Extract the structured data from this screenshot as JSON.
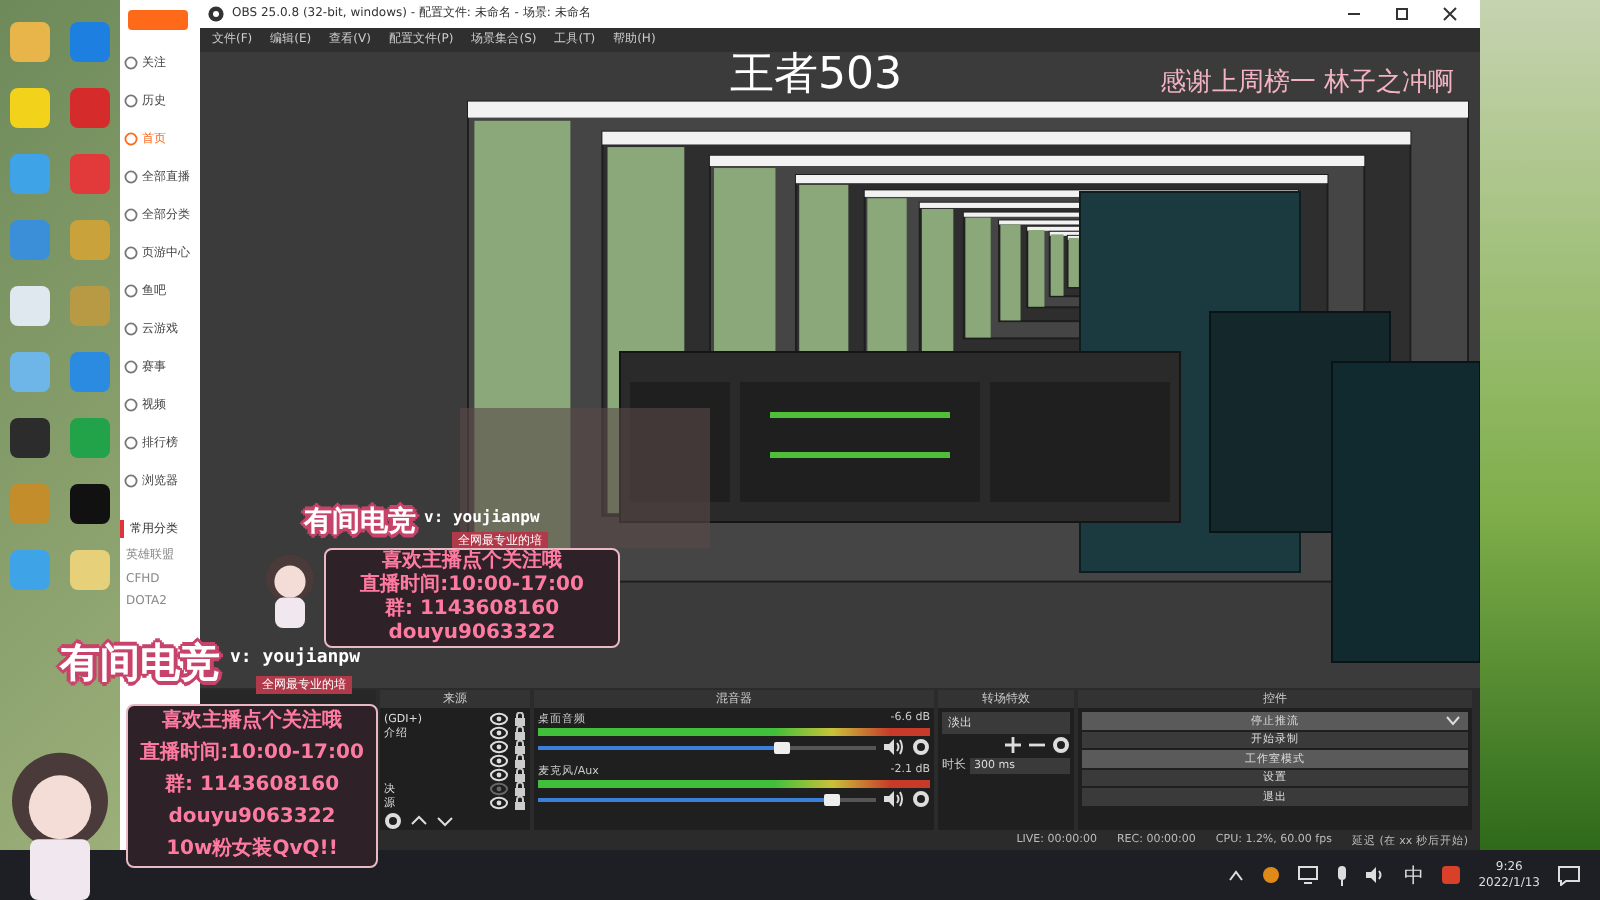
{
  "browser_sidebar": {
    "items": [
      {
        "label": "关注",
        "selected": false
      },
      {
        "label": "历史",
        "selected": false
      },
      {
        "label": "首页",
        "selected": true
      },
      {
        "label": "全部直播",
        "selected": false
      },
      {
        "label": "全部分类",
        "selected": false
      },
      {
        "label": "页游中心",
        "selected": false
      },
      {
        "label": "鱼吧",
        "selected": false
      },
      {
        "label": "云游戏",
        "selected": false
      },
      {
        "label": "赛事",
        "selected": false
      },
      {
        "label": "视频",
        "selected": false
      },
      {
        "label": "排行榜",
        "selected": false
      },
      {
        "label": "浏览器",
        "selected": false
      }
    ],
    "section_title": "常用分类",
    "categories": [
      "英雄联盟",
      "CFHD",
      "DOTA2"
    ]
  },
  "obs": {
    "title": "OBS 25.0.8 (32-bit, windows) - 配置文件: 未命名 - 场景: 未命名",
    "menu": [
      "文件(F)",
      "编辑(E)",
      "查看(V)",
      "配置文件(P)",
      "场景集合(S)",
      "工具(T)",
      "帮助(H)"
    ],
    "preview": {
      "headline": "王者503",
      "banner": "感谢上周榜一 林子之冲啊"
    },
    "sources": {
      "title": "来源",
      "items": [
        {
          "name": "(GDI+)",
          "visible": true
        },
        {
          "name": "介绍",
          "visible": true
        },
        {
          "visible": true
        },
        {
          "visible": true
        },
        {
          "visible": true
        },
        {
          "name": "决",
          "visible": false
        },
        {
          "name": "源",
          "visible": true
        }
      ]
    },
    "mixer": {
      "title": "混音器",
      "channels": [
        {
          "name": "桌面音频",
          "reading": "-6.6 dB",
          "level": 0.72
        },
        {
          "name": "麦克风/Aux",
          "reading": "-2.1 dB",
          "level": 0.87
        }
      ]
    },
    "transitions": {
      "title": "转场特效",
      "selected": "淡出",
      "duration_label": "时长",
      "duration": "300 ms"
    },
    "controls": {
      "title": "控件",
      "buttons": [
        {
          "label": "停止推流",
          "kind": "dropdown",
          "active": true
        },
        {
          "label": "开始录制",
          "kind": "plain",
          "active": false
        },
        {
          "label": "工作室模式",
          "kind": "plain",
          "active": true
        },
        {
          "label": "设置",
          "kind": "plain",
          "active": false
        },
        {
          "label": "退出",
          "kind": "plain",
          "active": false
        }
      ]
    },
    "status_bar": [
      "LIVE: 00:00:00",
      "REC: 00:00:00",
      "CPU: 1.2%, 60.00 fps",
      "延迟 (在 xx 秒后开始)"
    ]
  },
  "overlays": [
    {
      "title": "有间电竞",
      "handle": "v: youjianpw",
      "tagline": "全网最专业的培",
      "lines": [
        "喜欢主播点个关注哦",
        "直播时间:10:00-17:00",
        "群: 1143608160",
        "douyu9063322",
        "10w粉女装QvQ!!"
      ]
    },
    {
      "title": "有间电竞",
      "handle": "v: youjianpw",
      "tagline": "全网最专业的培",
      "lines": [
        "喜欢主播点个关注哦",
        "直播时间:10:00-17:00",
        "群: 1143608160",
        "douyu9063322"
      ]
    }
  ],
  "taskbar": {
    "ime": "中",
    "time": "9:26",
    "date": "2022/1/13"
  }
}
